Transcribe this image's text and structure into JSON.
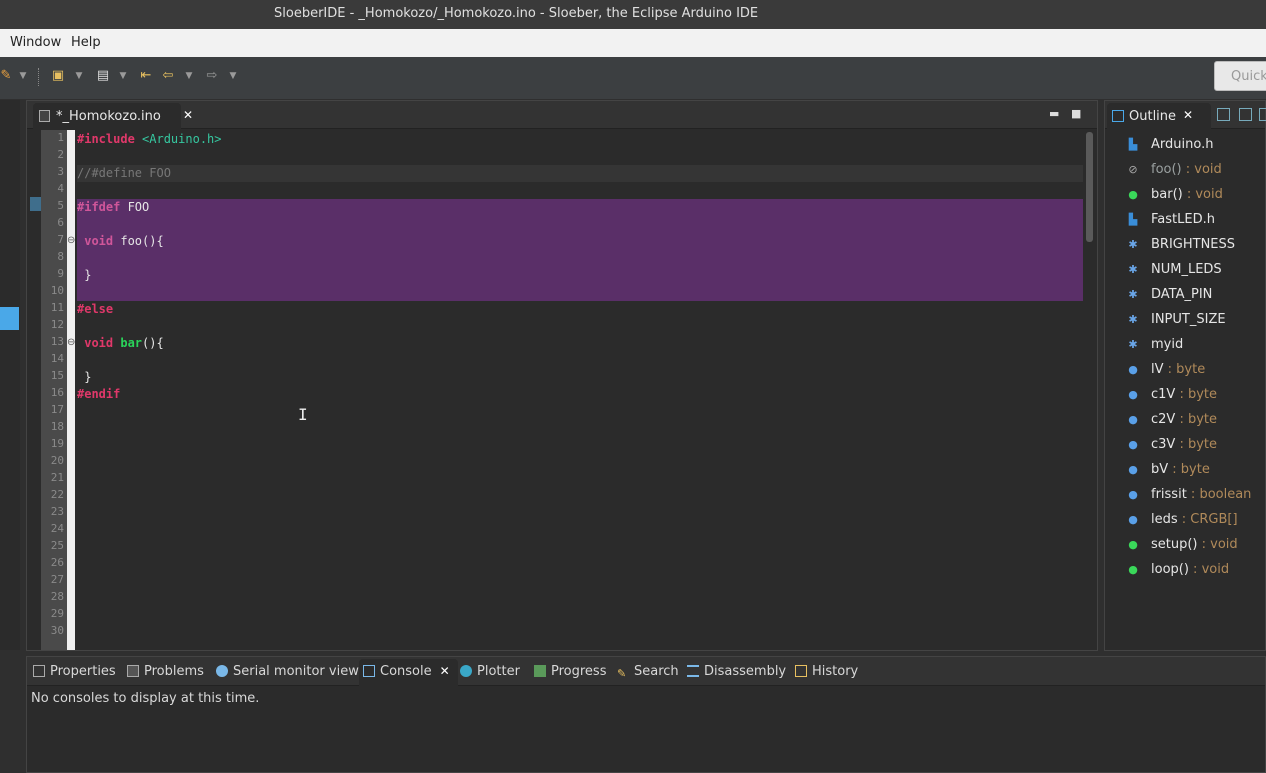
{
  "window": {
    "title": "SloeberIDE - _Homokozo/_Homokozo.ino - Sloeber, the Eclipse Arduino IDE"
  },
  "menu": {
    "items": [
      "Window",
      "Help"
    ]
  },
  "toolbar": {
    "quick_access": "Quick"
  },
  "editor": {
    "tab_label": "*_Homokozo.ino",
    "line_numbers": [
      "1",
      "2",
      "3",
      "4",
      "5",
      "6",
      "7",
      "8",
      "9",
      "10",
      "11",
      "12",
      "13",
      "14",
      "15",
      "16",
      "17",
      "18",
      "19",
      "20",
      "21",
      "22",
      "23",
      "24",
      "25",
      "26",
      "27",
      "28",
      "29",
      "30"
    ],
    "lines": {
      "l1_kw": "#include",
      "l1_inc": " <Arduino.h>",
      "l3": "//#define FOO",
      "l5_kw": "#ifdef",
      "l5_rest": " FOO",
      "l7_kw": " void",
      "l7_rest": " foo(){",
      "l9": " }",
      "l11_kw": "#else",
      "l13_kw": " void",
      "l13_fn": " bar",
      "l13_rest": "(){",
      "l15": " }",
      "l16_kw": "#endif"
    }
  },
  "outline": {
    "tab_label": "Outline",
    "items": [
      {
        "name": "Arduino.h",
        "type": "",
        "icon": "include-icon"
      },
      {
        "name": "foo()",
        "type": " : void",
        "icon": "inactive-function-icon"
      },
      {
        "name": "bar()",
        "type": " : void",
        "icon": "function-icon"
      },
      {
        "name": "FastLED.h",
        "type": "",
        "icon": "include-icon"
      },
      {
        "name": "BRIGHTNESS",
        "type": "",
        "icon": "macro-icon"
      },
      {
        "name": "NUM_LEDS",
        "type": "",
        "icon": "macro-icon"
      },
      {
        "name": "DATA_PIN",
        "type": "",
        "icon": "macro-icon"
      },
      {
        "name": "INPUT_SIZE",
        "type": "",
        "icon": "macro-icon"
      },
      {
        "name": "myid",
        "type": "",
        "icon": "macro-icon"
      },
      {
        "name": "lV",
        "type": " : byte",
        "icon": "variable-icon"
      },
      {
        "name": "c1V",
        "type": " : byte",
        "icon": "variable-icon"
      },
      {
        "name": "c2V",
        "type": " : byte",
        "icon": "variable-icon"
      },
      {
        "name": "c3V",
        "type": " : byte",
        "icon": "variable-icon"
      },
      {
        "name": "bV",
        "type": " : byte",
        "icon": "variable-icon"
      },
      {
        "name": "frissit",
        "type": " : boolean",
        "icon": "variable-icon"
      },
      {
        "name": "leds",
        "type": " : CRGB[]",
        "icon": "variable-icon"
      },
      {
        "name": "setup()",
        "type": " : void",
        "icon": "function-icon"
      },
      {
        "name": "loop()",
        "type": " : void",
        "icon": "function-icon"
      }
    ]
  },
  "bottom_panel": {
    "tabs": [
      "Properties",
      "Problems",
      "Serial monitor view",
      "Console",
      "Plotter",
      "Progress",
      "Search",
      "Disassembly",
      "History"
    ],
    "active_tab": "Console",
    "console_message": "No consoles to display at this time."
  },
  "colors": {
    "keyword": "#e0386a",
    "include_string": "#36c7a0",
    "inactive_block": "#5a2f68",
    "function_name": "#2ad45a",
    "type_suffix": "#b08a5a"
  }
}
